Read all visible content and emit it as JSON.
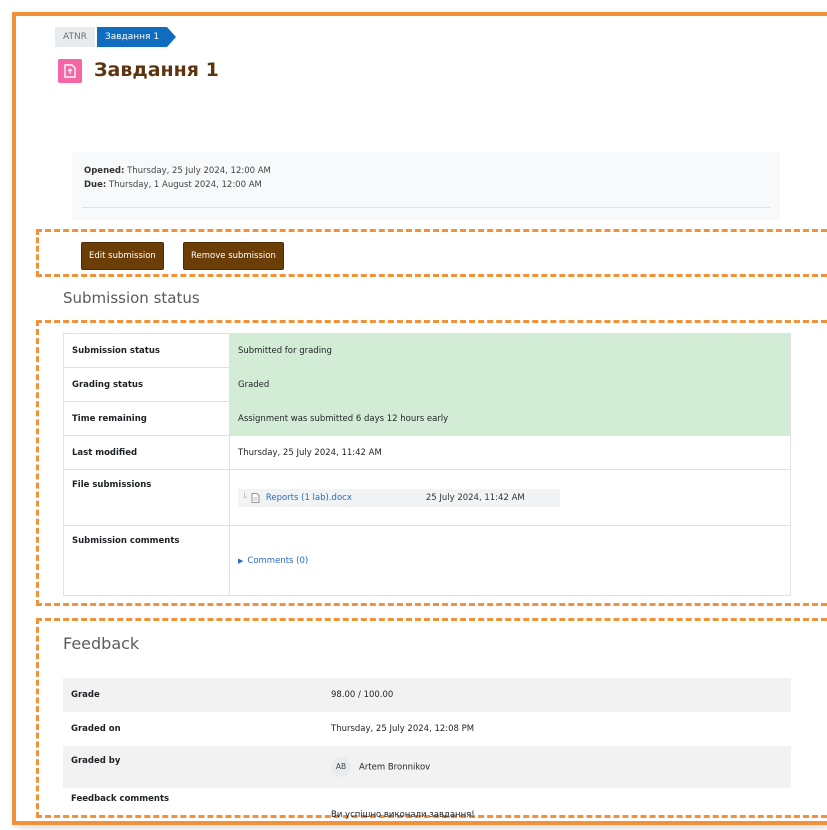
{
  "breadcrumb": [
    "ATNR",
    "Завдання 1"
  ],
  "title": "Завдання 1",
  "dates": {
    "opened_label": "Opened:",
    "opened_value": "Thursday, 25 July 2024, 12:00 AM",
    "due_label": "Due:",
    "due_value": "Thursday, 1 August 2024, 12:00 AM"
  },
  "buttons": {
    "edit": "Edit submission",
    "remove": "Remove submission"
  },
  "submission_status": {
    "heading": "Submission status",
    "rows": [
      {
        "label": "Submission status",
        "value": "Submitted for grading"
      },
      {
        "label": "Grading status",
        "value": "Graded"
      },
      {
        "label": "Time remaining",
        "value": "Assignment was submitted 6 days 12 hours early"
      },
      {
        "label": "Last modified",
        "value": "Thursday, 25 July 2024, 11:42 AM"
      },
      {
        "label": "File submissions",
        "file_name": "Reports (1 lab).docx",
        "file_date": "25 July 2024, 11:42 AM"
      },
      {
        "label": "Submission comments",
        "comments": "Comments (0)"
      }
    ]
  },
  "feedback": {
    "heading": "Feedback",
    "rows": [
      {
        "label": "Grade",
        "value": "98.00 / 100.00"
      },
      {
        "label": "Graded on",
        "value": "Thursday, 25 July 2024, 12:08 PM"
      },
      {
        "label": "Graded by",
        "initials": "AB",
        "value": "Artem Bronnikov"
      },
      {
        "label": "Feedback comments",
        "value": "Ви успішно виконали завдання!"
      }
    ]
  },
  "colors": {
    "accent_border": "#f0923a",
    "button": "#6b3d07",
    "title": "#5c3510",
    "breadcrumb_active": "#0f6cbf",
    "status_green": "#d3ecd5",
    "icon_pink": "#f466a4"
  }
}
